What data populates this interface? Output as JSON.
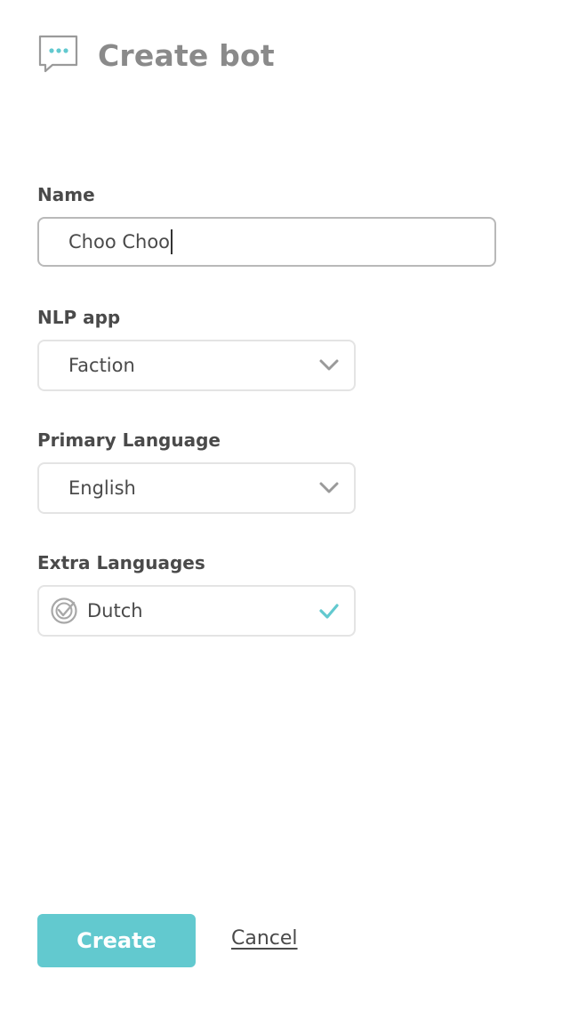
{
  "header": {
    "title": "Create bot",
    "icon": "chat-bubble-icon",
    "accent_color": "#62c9cf"
  },
  "form": {
    "name": {
      "label": "Name",
      "value": "Choo Choo"
    },
    "nlp_app": {
      "label": "NLP app",
      "selected": "Faction"
    },
    "primary_language": {
      "label": "Primary Language",
      "selected": "English"
    },
    "extra_languages": {
      "label": "Extra Languages",
      "selected": "Dutch",
      "checked": true
    }
  },
  "actions": {
    "create_label": "Create",
    "cancel_label": "Cancel",
    "create_color": "#62c9cf"
  }
}
